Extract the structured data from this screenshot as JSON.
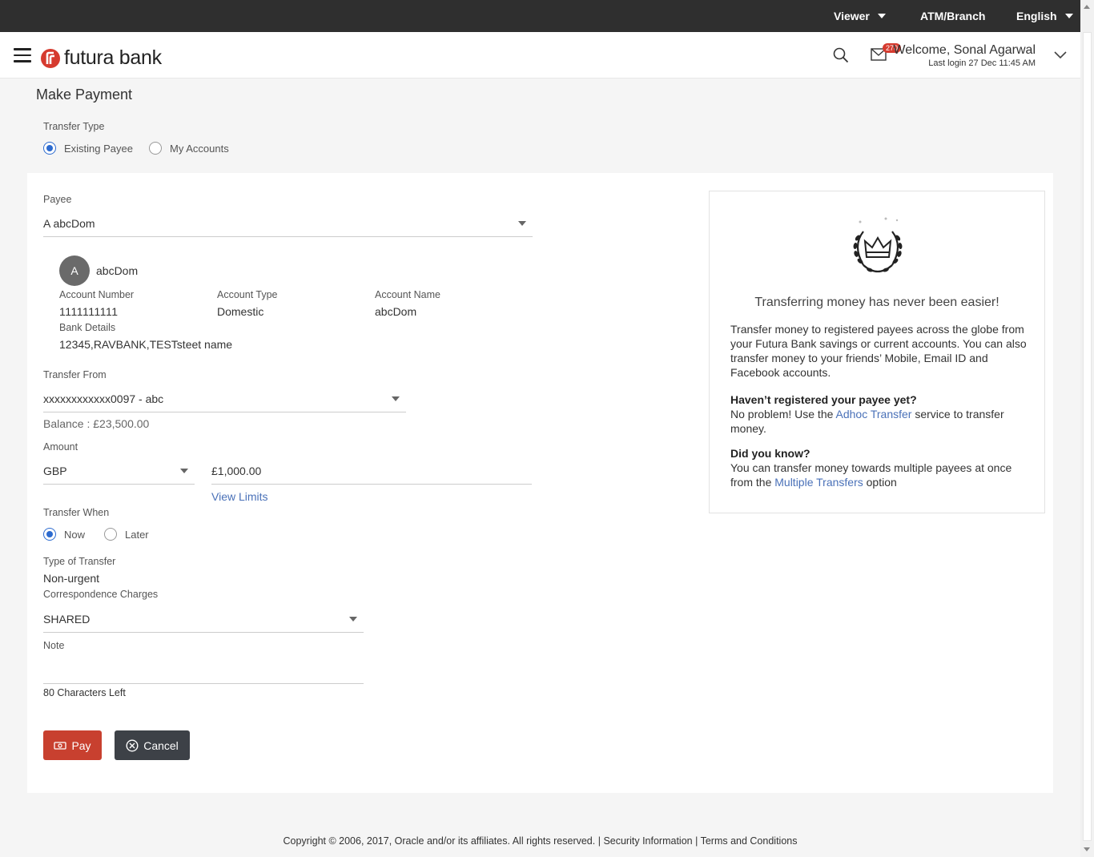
{
  "topbar": {
    "viewer": "Viewer",
    "atm_branch": "ATM/Branch",
    "language": "English"
  },
  "header": {
    "logo_text": "futura bank",
    "mail_count": "270",
    "welcome": "Welcome, Sonal Agarwal",
    "last_login": "Last login 27 Dec 11:45 AM"
  },
  "page": {
    "title": "Make Payment"
  },
  "transfer_type": {
    "label": "Transfer Type",
    "options": [
      "Existing Payee",
      "My Accounts"
    ],
    "selected": "Existing Payee"
  },
  "payee": {
    "label": "Payee",
    "value": "A abcDom",
    "avatar_initial": "A",
    "name": "abcDom",
    "account_number_label": "Account Number",
    "account_number": "1111111111",
    "account_type_label": "Account Type",
    "account_type": "Domestic",
    "account_name_label": "Account Name",
    "account_name": "abcDom",
    "bank_details_label": "Bank Details",
    "bank_details": "12345,RAVBANK,TESTsteet name"
  },
  "transfer_from": {
    "label": "Transfer From",
    "value": "xxxxxxxxxxxx0097 - abc",
    "balance": "Balance : £23,500.00"
  },
  "amount": {
    "label": "Amount",
    "currency": "GBP",
    "value": "£1,000.00",
    "view_limits": "View Limits"
  },
  "transfer_when": {
    "label": "Transfer When",
    "options": [
      "Now",
      "Later"
    ],
    "selected": "Now"
  },
  "type_of_transfer": {
    "label": "Type of Transfer",
    "value": "Non-urgent"
  },
  "correspondence": {
    "label": "Correspondence Charges",
    "value": "SHARED"
  },
  "note": {
    "label": "Note",
    "value": "",
    "chars_left": "80 Characters Left"
  },
  "buttons": {
    "pay": "Pay",
    "cancel": "Cancel"
  },
  "info": {
    "title": "Transferring money has never been easier!",
    "para1": "Transfer money to registered payees across the globe from your Futura Bank savings or current accounts. You can also transfer money to your friends’ Mobile, Email ID and Facebook accounts.",
    "head2": "Haven’t registered your payee yet?",
    "para2_pre": "No problem! Use the ",
    "para2_link": "Adhoc Transfer",
    "para2_post": " service to transfer money.",
    "head3": "Did you know?",
    "para3_pre": "You can transfer money towards multiple payees at once from the ",
    "para3_link": "Multiple Transfers",
    "para3_post": " option"
  },
  "footer": {
    "copyright": "Copyright © 2006, 2017, Oracle and/or its affiliates. All rights reserved.",
    "sep1": " | ",
    "security": "Security Information",
    "sep2": " | ",
    "terms": "Terms and Conditions"
  },
  "colors": {
    "accent": "#2d6bcf",
    "pay_button": "#c8402f",
    "cancel_button": "#3d4147",
    "topbar": "#2f2f2f",
    "brand": "#d63b2f"
  }
}
